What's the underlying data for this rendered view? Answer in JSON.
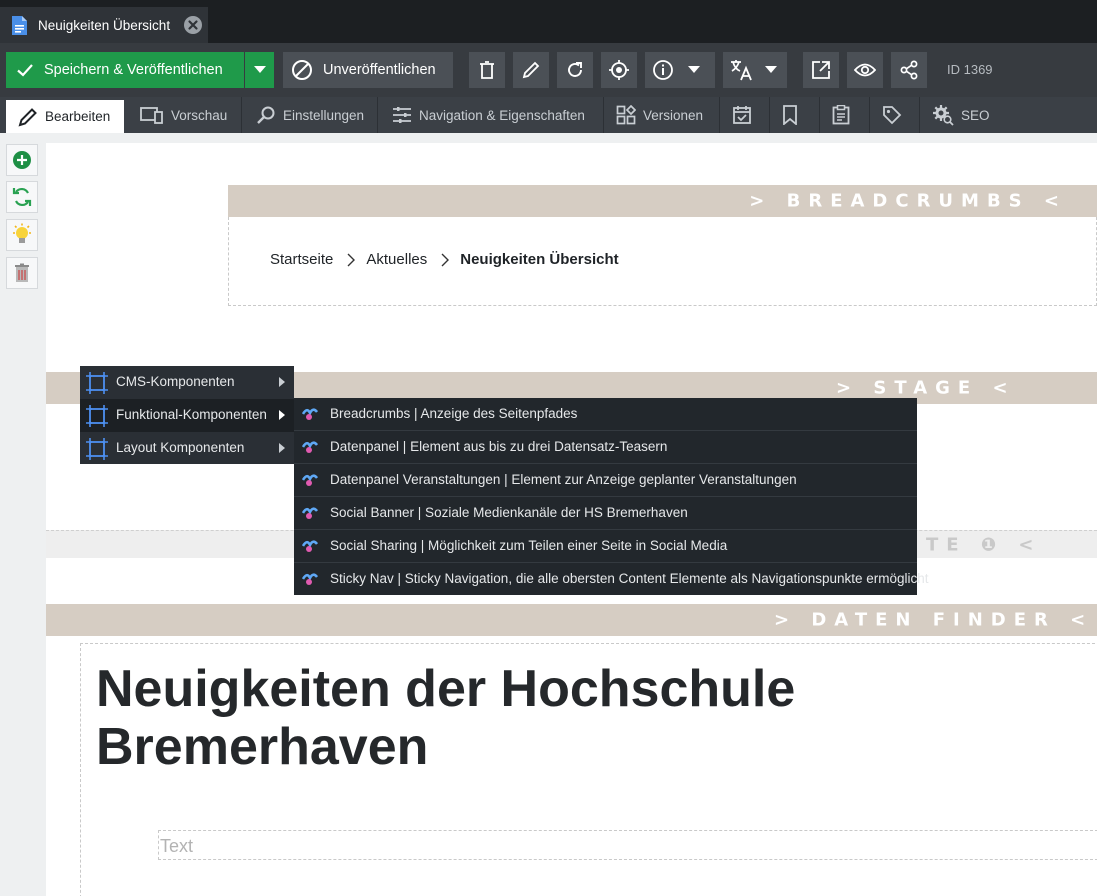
{
  "window": {
    "tab_title": "Neuigkeiten Übersicht"
  },
  "toolbar": {
    "save_label": "Speichern & Veröffentlichen",
    "unpublish_label": "Unveröffentlichen",
    "id_label": "ID 1369"
  },
  "edit_tabs": [
    {
      "label": "Bearbeiten",
      "active": true
    },
    {
      "label": "Vorschau"
    },
    {
      "label": "Einstellungen"
    },
    {
      "label": "Navigation & Eigenschaften"
    },
    {
      "label": "Versionen"
    },
    {
      "label": "SEO"
    }
  ],
  "content": {
    "breadcrumbs_band": "> BREADCRUMBS <",
    "crumbs": [
      "Startseite",
      "Aktuelles",
      "Neuigkeiten Übersicht"
    ],
    "stage_band": "> STAGE <",
    "hidden_band": "TE ❶ <",
    "daten_finder_band": "> DATEN FINDER <",
    "headline": "Neuigkeiten der Hochschule Bremerhaven",
    "text_placeholder": "Text"
  },
  "context_menu": {
    "items": [
      {
        "label": "CMS-Komponenten"
      },
      {
        "label": "Funktional-Komponenten",
        "hovered": true
      },
      {
        "label": "Layout Komponenten"
      }
    ],
    "submenu": [
      {
        "label": "Breadcrumbs | Anzeige des Seitenpfades"
      },
      {
        "label": "Datenpanel | Element aus bis zu drei Datensatz-Teasern"
      },
      {
        "label": "Datenpanel Veranstaltungen | Element zur Anzeige geplanter Veranstaltungen"
      },
      {
        "label": "Social Banner | Soziale Medienkanäle der HS Bremerhaven"
      },
      {
        "label": "Social Sharing | Möglichkeit zum Teilen einer Seite in Social Media"
      },
      {
        "label": "Sticky Nav | Sticky Navigation, die alle obersten Content Elemente als Navigationspunkte ermöglicht"
      }
    ]
  },
  "colors": {
    "save_green": "#1f9a4a",
    "band_beige": "#d6cdc3",
    "toolbar_dark": "#373b40",
    "menu_dark": "#2a2f35"
  }
}
